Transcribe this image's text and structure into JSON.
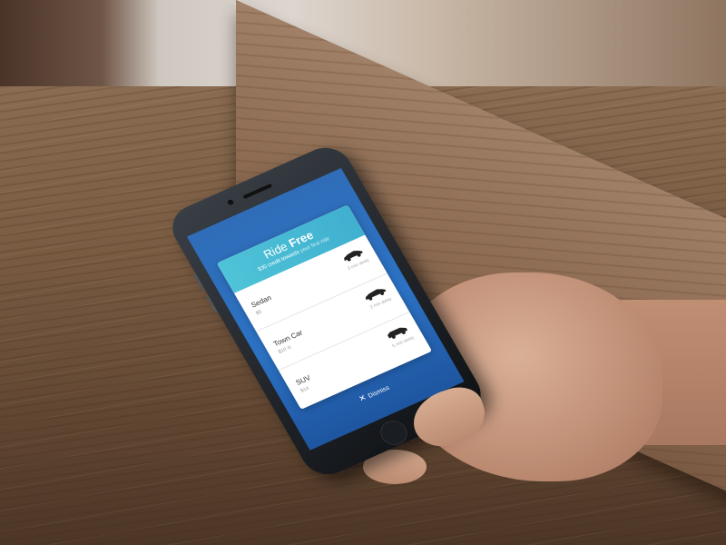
{
  "promo": {
    "title_part1": "Ride ",
    "title_part2": "Free",
    "subtitle_main": "$30 credit towards ",
    "subtitle_rest": "your first ride"
  },
  "options": [
    {
      "name": "Sedan",
      "price": "$5",
      "eta": "3 min away"
    },
    {
      "name": "Town Car",
      "price": "$10 ⊙",
      "eta": "2 min away"
    },
    {
      "name": "SUV",
      "price": "$14",
      "eta": "5 min away"
    }
  ],
  "dismiss": {
    "icon": "close-icon",
    "label": "Dismiss"
  },
  "colors": {
    "header_gradient_start": "#4fc3d8",
    "header_gradient_end": "#3fb0cf",
    "screen_background": "#2c72c4"
  },
  "icons": [
    "car-icon",
    "close-icon"
  ]
}
